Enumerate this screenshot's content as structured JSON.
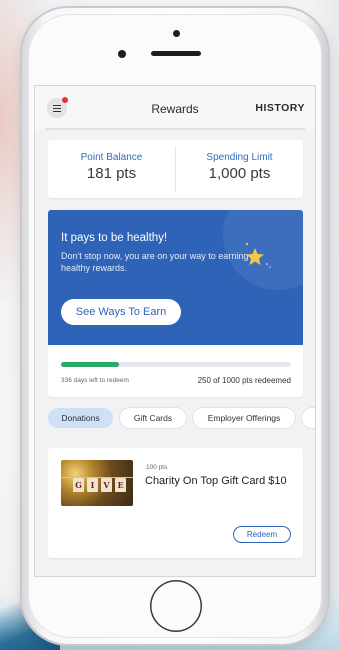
{
  "header": {
    "title": "Rewards",
    "history_label": "HISTORY"
  },
  "stats": {
    "point_balance_label": "Point Balance",
    "point_balance_value": "181 pts",
    "spending_limit_label": "Spending Limit",
    "spending_limit_value": "1,000 pts"
  },
  "promo": {
    "title": "It pays to be healthy!",
    "subtitle": "Don't stop now, you are on your way to earning healthy rewards.",
    "button_label": "See Ways To Earn"
  },
  "progress": {
    "fraction": 0.25,
    "days_left": "336 days left to redeem",
    "redeemed_text": "250 of 1000 pts redeemed"
  },
  "tabs": [
    {
      "label": "Donations",
      "active": true
    },
    {
      "label": "Gift Cards",
      "active": false
    },
    {
      "label": "Employer Offerings",
      "active": false
    }
  ],
  "gift_card": {
    "image_letters": [
      "G",
      "I",
      "V",
      "E"
    ],
    "points": "100 pts",
    "title": "Charity On Top Gift Card $10",
    "redeem_label": "Redeem"
  },
  "colors": {
    "accent_blue": "#2e63b8",
    "progress_green": "#2aaa6b",
    "notification_red": "#e8322e"
  }
}
